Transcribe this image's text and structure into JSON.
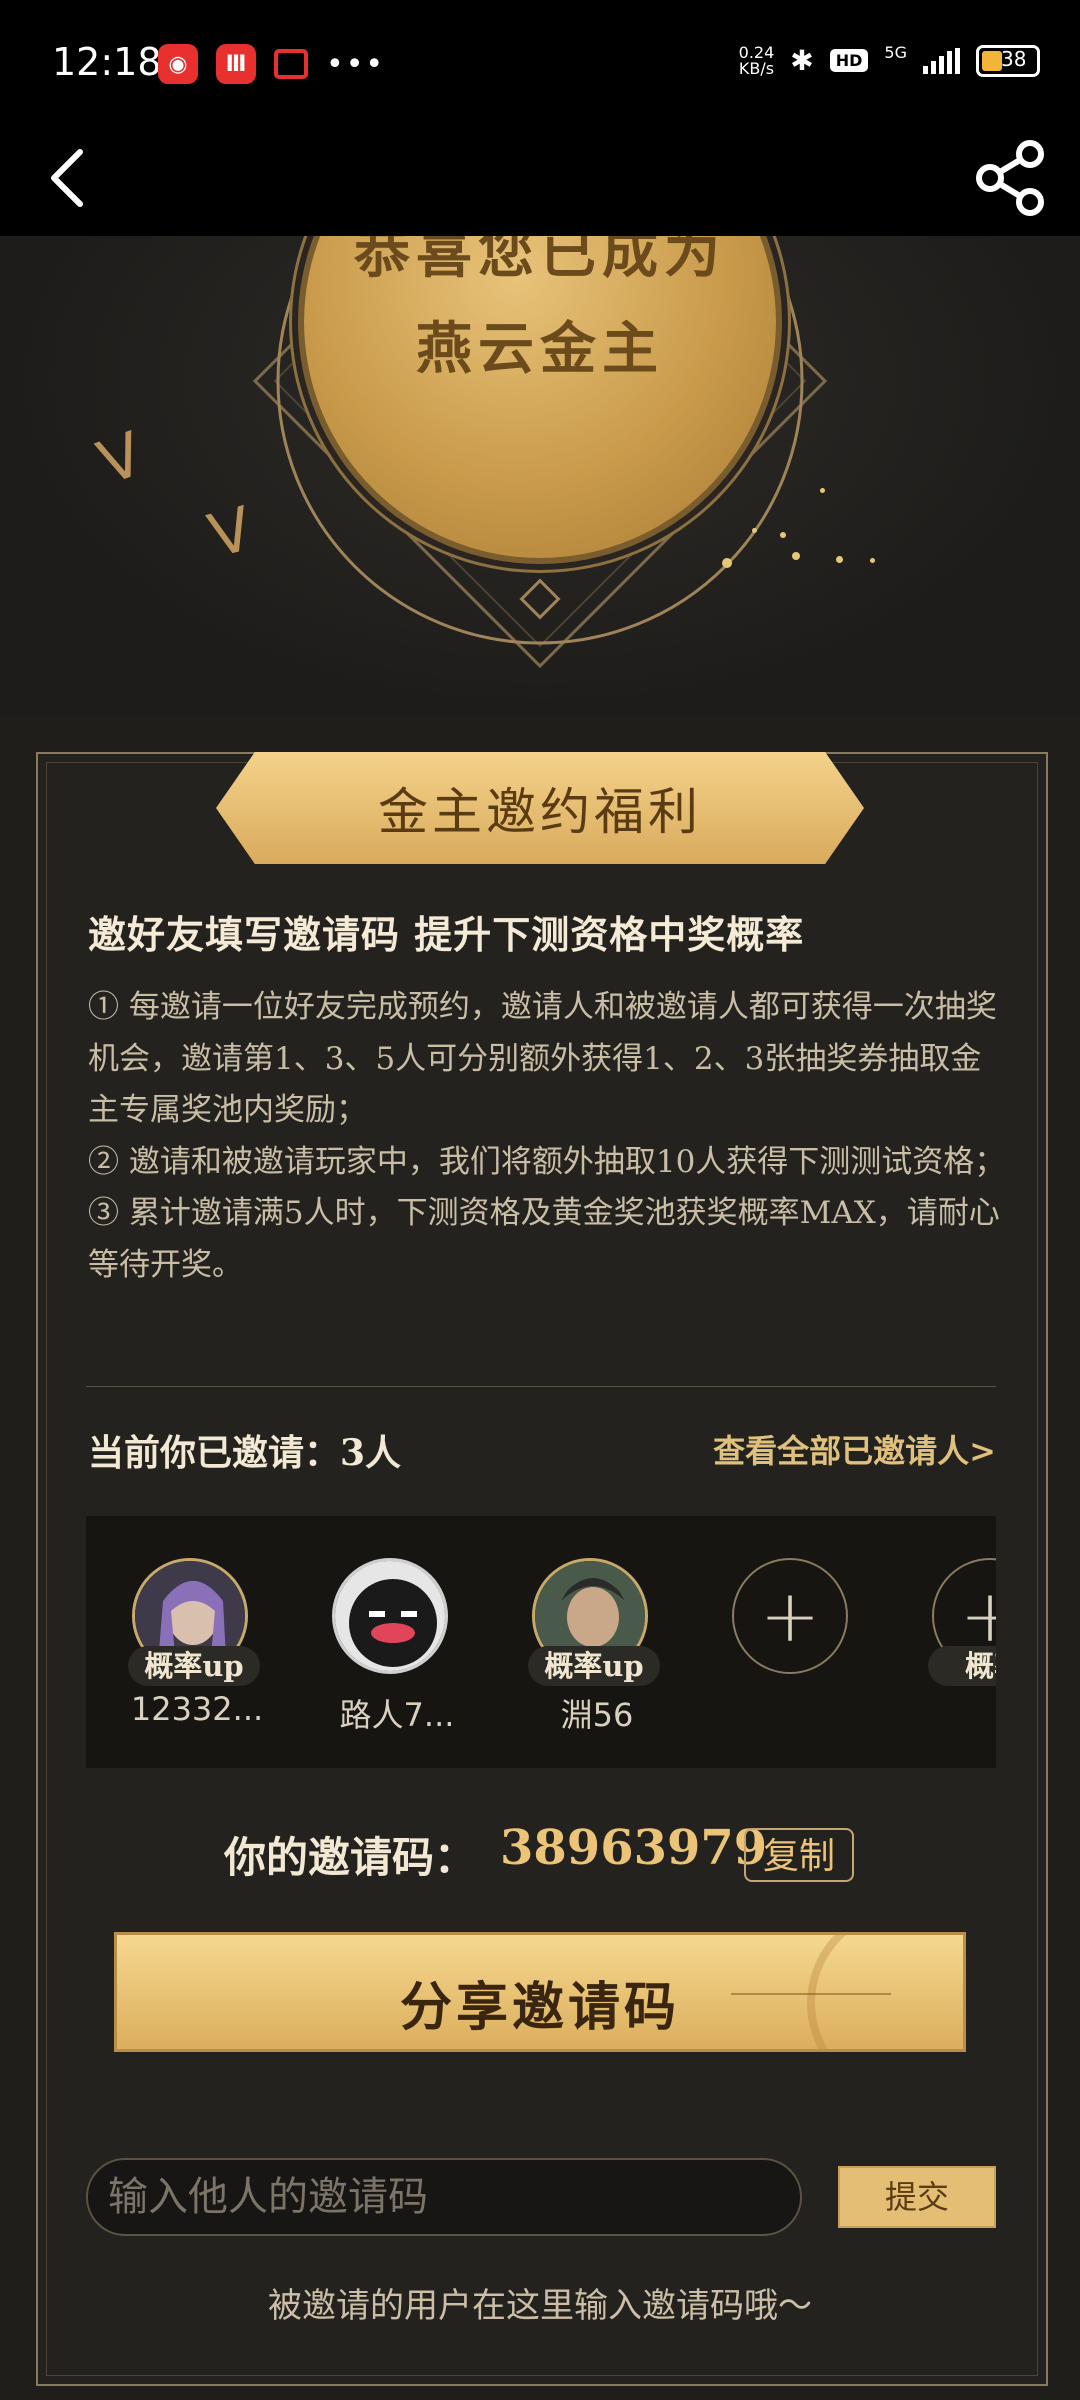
{
  "status_bar": {
    "time": "12:18",
    "net_speed": "0.24",
    "net_unit": "KB/s",
    "network": "5G",
    "hd": "HD",
    "battery": "38"
  },
  "hero": {
    "line1": "恭喜您已成为",
    "line2": "燕云金主"
  },
  "banner": {
    "title": "金主邀约福利"
  },
  "headline": "邀好友填写邀请码 提升下测资格中奖概率",
  "rules": [
    "① 每邀请一位好友完成预约，邀请人和被邀请人都可获得一次抽奖机会，邀请第1、3、5人可分别额外获得1、2、3张抽奖券抽取金主专属奖池内奖励；",
    "② 邀请和被邀请玩家中，我们将额外抽取10人获得下测测试资格；",
    "③ 累计邀请满5人时，下测资格及黄金奖池获奖概率MAX，请耐心等待开奖。"
  ],
  "invited": {
    "label": "当前你已邀请：3人",
    "view_all": "查看全部已邀请人>",
    "badge": "概率up",
    "badge_partial": "概率",
    "users": [
      {
        "name": "12332..."
      },
      {
        "name": "路人7..."
      },
      {
        "name": "淵56"
      }
    ]
  },
  "invite_code": {
    "label": "你的邀请码：",
    "value": "38963979",
    "copy": "复制"
  },
  "share_button": "分享邀请码",
  "code_input": {
    "placeholder": "输入他人的邀请码"
  },
  "submit": "提交",
  "hint": "被邀请的用户在这里输入邀请码哦～"
}
